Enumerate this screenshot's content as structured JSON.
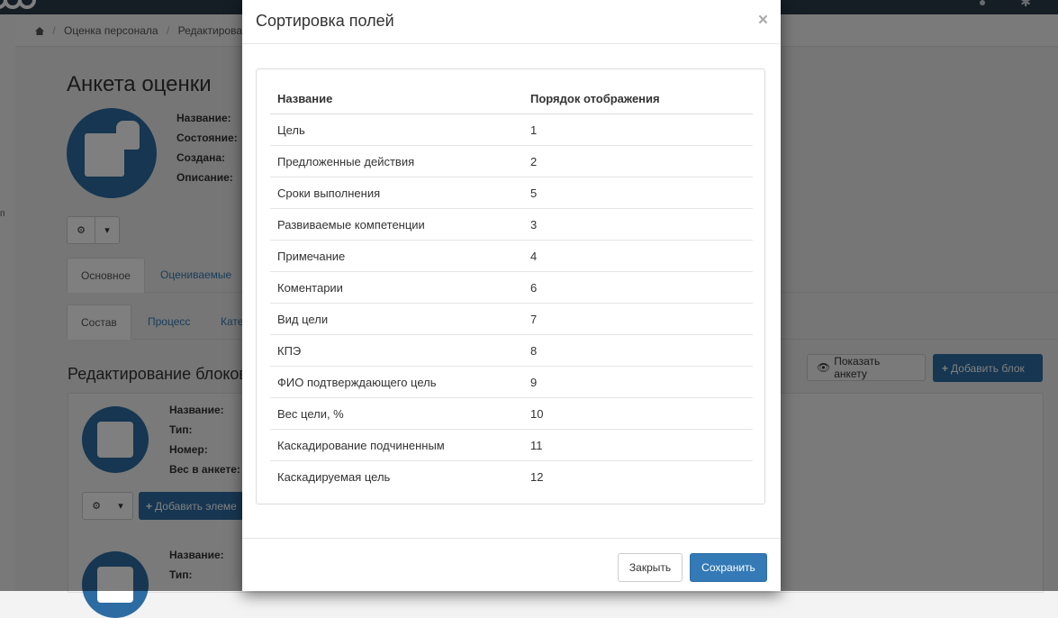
{
  "breadcrumb": [
    "Оценка персонала",
    "Редактирование а"
  ],
  "left_edge_text": "п",
  "page": {
    "title": "Анкета оценки",
    "info_labels": [
      "Название:",
      "Состояние:",
      "Создана:",
      "Описание:"
    ]
  },
  "tabs": [
    "Основное",
    "Оцениваемые"
  ],
  "subtabs": [
    "Состав",
    "Процесс",
    "Кате"
  ],
  "section": {
    "title": "Редактирование блоков",
    "show_button": "Показать анкету",
    "add_block_button": "Добавить блок"
  },
  "block1": {
    "labels": [
      "Название:",
      "Тип:",
      "Номер:",
      "Вес в анкете:"
    ],
    "add_element_button": "Добавить элеме"
  },
  "block2": {
    "labels": [
      "Название:",
      "Тип:"
    ]
  },
  "modal": {
    "title": "Сортировка полей",
    "close_symbol": "×",
    "headers": [
      "Название",
      "Порядок отображения"
    ],
    "rows": [
      {
        "name": "Цель",
        "order": "1"
      },
      {
        "name": "Предложенные действия",
        "order": "2"
      },
      {
        "name": "Сроки выполнения",
        "order": "5"
      },
      {
        "name": "Развиваемые компетенции",
        "order": "3"
      },
      {
        "name": "Примечание",
        "order": "4"
      },
      {
        "name": "Коментарии",
        "order": "6"
      },
      {
        "name": "Вид цели",
        "order": "7"
      },
      {
        "name": "КПЭ",
        "order": "8"
      },
      {
        "name": "ФИО подтверждающего цель",
        "order": "9"
      },
      {
        "name": "Вес цели, %",
        "order": "10"
      },
      {
        "name": "Каскадирование подчиненным",
        "order": "11"
      },
      {
        "name": "Каскадируемая цель",
        "order": "12"
      }
    ],
    "close_button": "Закрыть",
    "save_button": "Сохранить"
  },
  "colors": {
    "primary": "#337ab7",
    "dark_blue": "#2d6ca2",
    "topbar": "#2b3a4a"
  },
  "icons": {
    "home": "home-icon",
    "gear": "gear-icon",
    "caret": "caret-down-icon",
    "eye": "eye-icon",
    "plus": "plus-icon",
    "close": "close-icon"
  }
}
